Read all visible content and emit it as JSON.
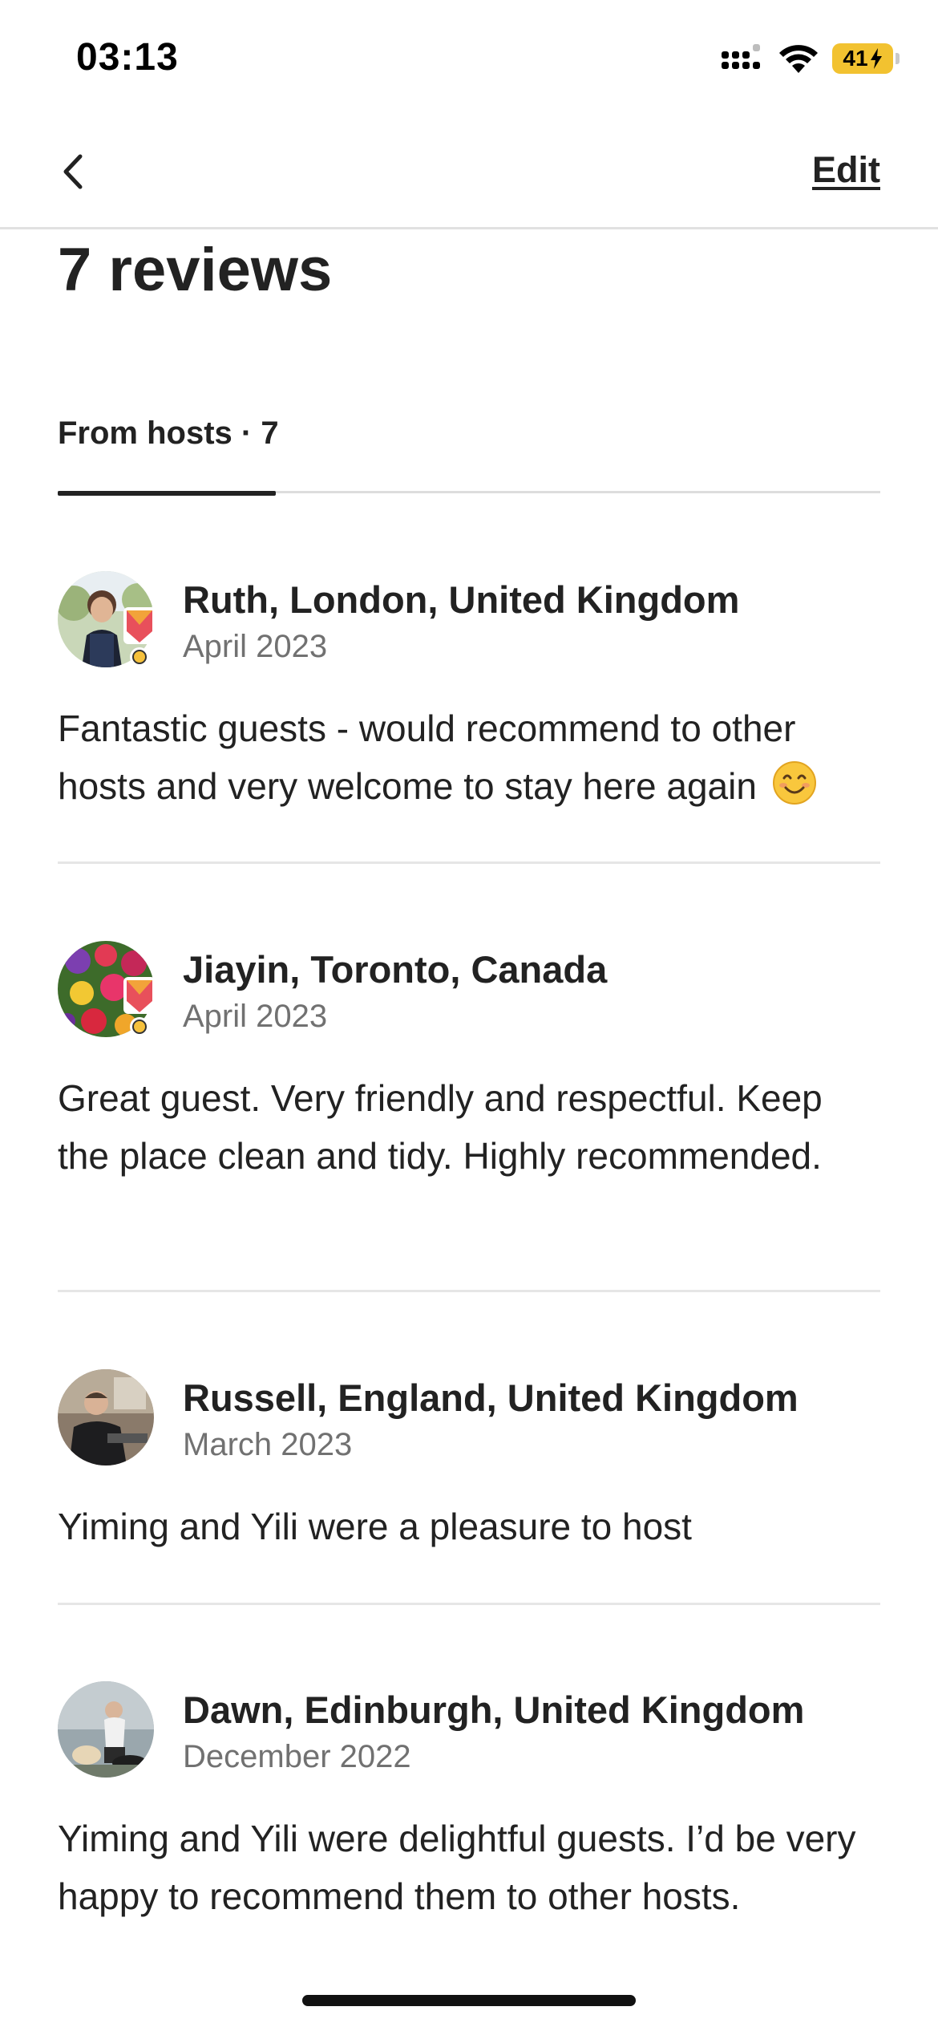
{
  "status_bar": {
    "time": "03:13",
    "battery_level": "41",
    "battery_charging": true,
    "icons": [
      "signal-icon",
      "wifi-icon",
      "battery-icon"
    ],
    "battery_color": "#f2c230"
  },
  "nav": {
    "back_icon": "chevron-left-icon",
    "edit_label": "Edit"
  },
  "header": {
    "title": "7 reviews"
  },
  "tabs": [
    {
      "label": "From hosts · 7",
      "active": true
    }
  ],
  "reviews": [
    {
      "name": "Ruth, London, United Kingdom",
      "date": "April 2023",
      "text": "Fantastic guests - would recommend to other hosts and very welcome to stay here again",
      "emoji": "smiling-face-icon",
      "superhost": true
    },
    {
      "name": "Jiayin, Toronto, Canada",
      "date": "April 2023",
      "text": "Great guest. Very friendly and respectful. Keep the place clean and tidy. Highly recommended.",
      "superhost": true
    },
    {
      "name": "Russell, England, United Kingdom",
      "date": "March 2023",
      "text": "Yiming and Yili were a pleasure to host",
      "superhost": false
    },
    {
      "name": "Dawn, Edinburgh, United Kingdom",
      "date": "December 2022",
      "text": "Yiming and Yili were delightful guests. I’d be very happy to recommend them to other hosts.",
      "superhost": false
    }
  ],
  "colors": {
    "text_primary": "#222222",
    "text_secondary": "#717171",
    "divider": "#e6e6e6",
    "badge_red": "#e8505b"
  }
}
